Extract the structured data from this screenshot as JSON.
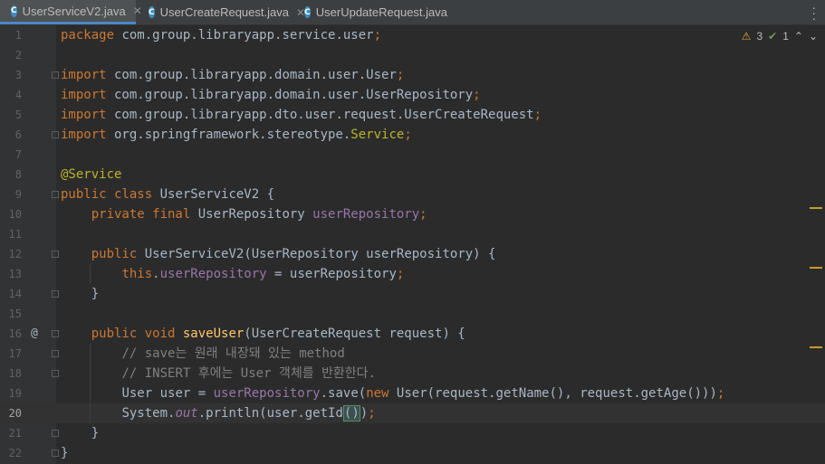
{
  "tabs": [
    {
      "label": "UserServiceV2.java",
      "active": true
    },
    {
      "label": "UserCreateRequest.java",
      "active": false
    },
    {
      "label": "UserUpdateRequest.java",
      "active": false
    }
  ],
  "inspections": {
    "warnings": "3",
    "checks": "1"
  },
  "lines": [
    {
      "n": "1"
    },
    {
      "n": "2"
    },
    {
      "n": "3"
    },
    {
      "n": "4"
    },
    {
      "n": "5"
    },
    {
      "n": "6"
    },
    {
      "n": "7"
    },
    {
      "n": "8"
    },
    {
      "n": "9"
    },
    {
      "n": "10"
    },
    {
      "n": "11"
    },
    {
      "n": "12"
    },
    {
      "n": "13"
    },
    {
      "n": "14"
    },
    {
      "n": "15"
    },
    {
      "n": "16"
    },
    {
      "n": "17"
    },
    {
      "n": "18"
    },
    {
      "n": "19"
    },
    {
      "n": "20"
    },
    {
      "n": "21"
    },
    {
      "n": "22"
    }
  ],
  "code": {
    "l1": {
      "kw": "package",
      "rest": " com.group.libraryapp.service.user",
      "semi": ";"
    },
    "l3": {
      "kw": "import",
      "rest": " com.group.libraryapp.domain.user.User",
      "semi": ";"
    },
    "l4": {
      "kw": "import",
      "rest": " com.group.libraryapp.domain.user.UserRepository",
      "semi": ";"
    },
    "l5": {
      "kw": "import",
      "rest": " com.group.libraryapp.dto.user.request.UserCreateRequest",
      "semi": ";"
    },
    "l6": {
      "kw": "import",
      "rest": " org.springframework.stereotype.",
      "ann": "Service",
      "semi": ";"
    },
    "l8": {
      "ann": "@Service"
    },
    "l9": {
      "kw": "public class",
      "name": " UserServiceV2",
      "rest": " {"
    },
    "l10": {
      "kw": "private final",
      "type": " UserRepository ",
      "fld": "userRepository",
      "semi": ";"
    },
    "l12": {
      "kw": "public",
      "name": " UserServiceV2",
      "rest": "(UserRepository userRepository) {"
    },
    "l13": {
      "kw": "this",
      "dot": ".",
      "fld": "userRepository",
      "rest": " = userRepository",
      "semi": ";"
    },
    "l14": {
      "rest": "}"
    },
    "l16": {
      "kw": "public void",
      "fn": " saveUser",
      "rest": "(UserCreateRequest request) {"
    },
    "l17": {
      "cm": "// save는 원래 내장돼 있는 method"
    },
    "l18": {
      "cm": "// INSERT 후에는 User 객체를 반환한다."
    },
    "l19": {
      "a": "User user = ",
      "fld": "userRepository",
      "b": ".save(",
      "kw": "new",
      "c": " User(request.getName(), request.getAge()))",
      "semi": ";"
    },
    "l20": {
      "a": "System.",
      "fld": "out",
      "b": ".println(user.getId",
      "m": "()",
      "c": ")",
      "semi": ";"
    },
    "l21": {
      "rest": "}"
    },
    "l22": {
      "rest": "}"
    }
  }
}
